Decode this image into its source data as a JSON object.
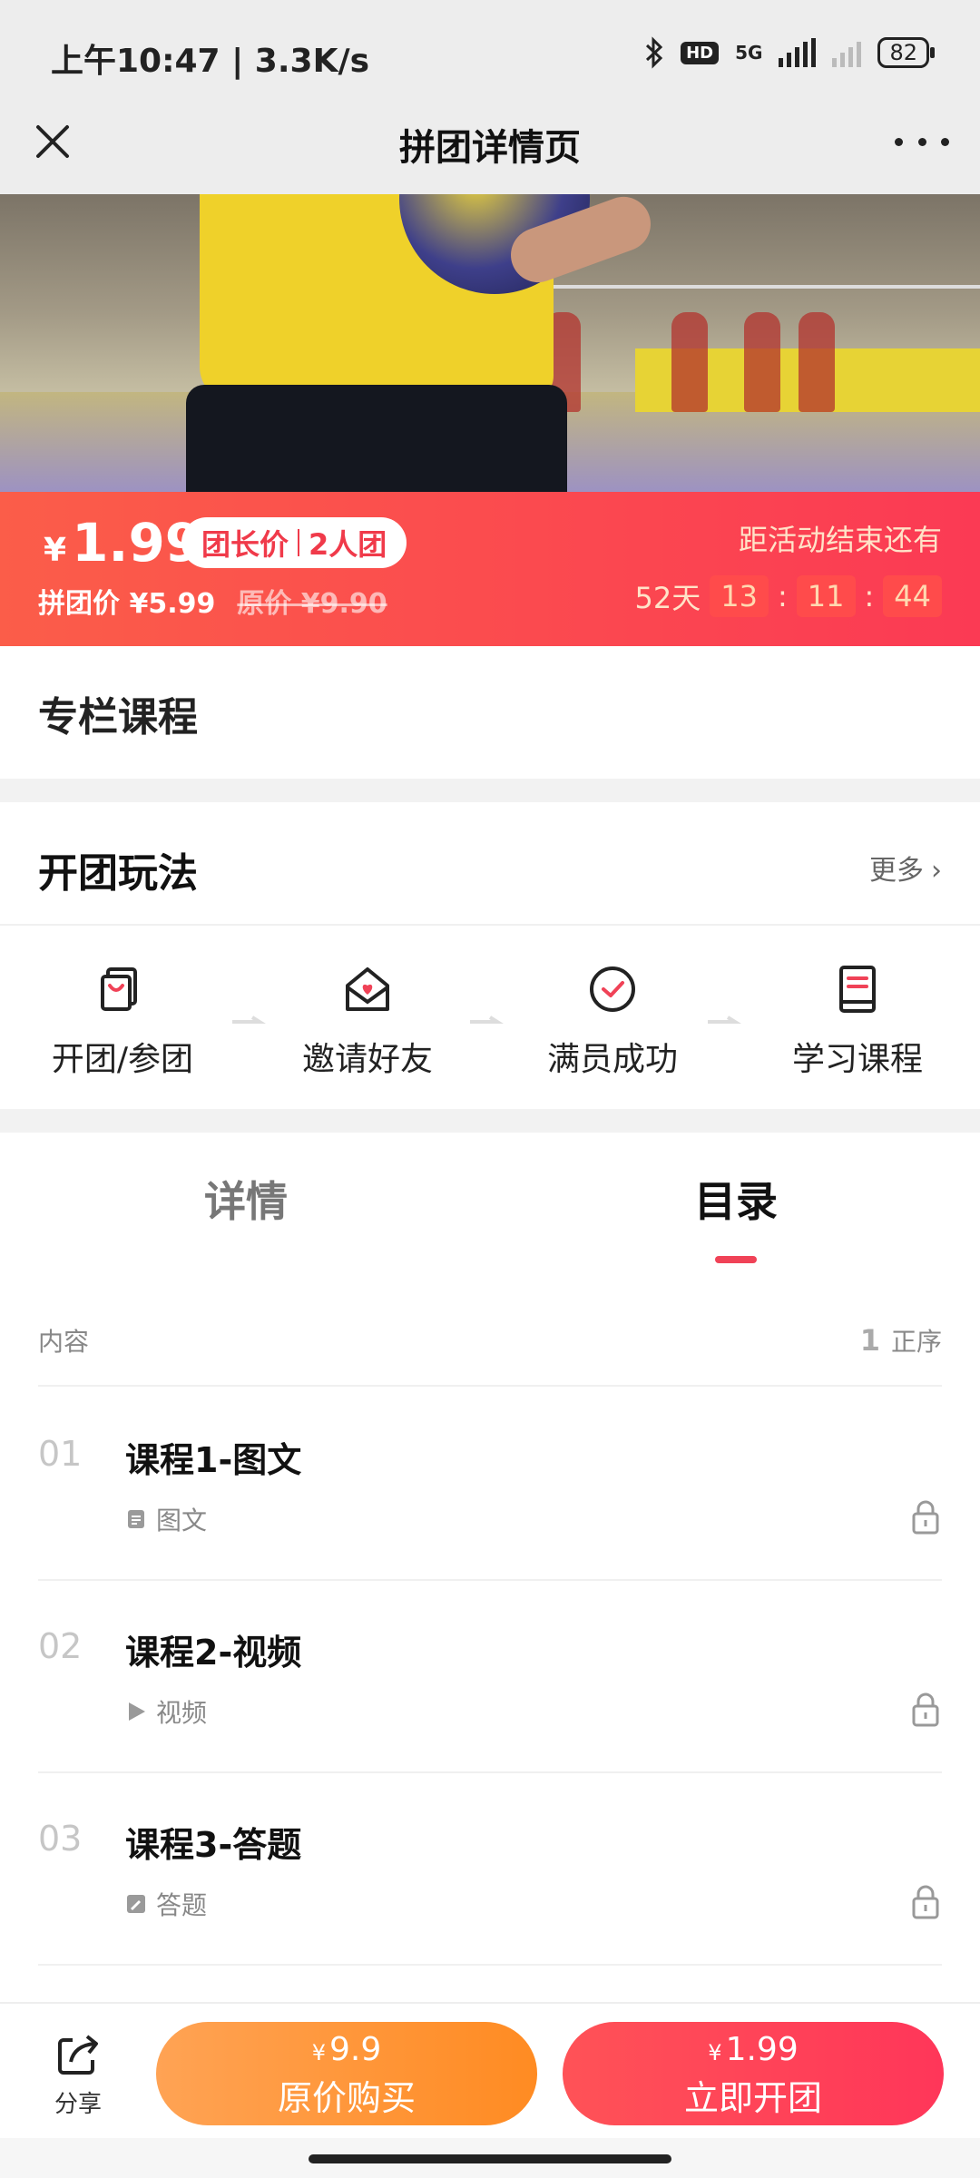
{
  "status_bar": {
    "time_speed": "上午10:47 | 3.3K/s",
    "network": "5G",
    "hd": "HD",
    "battery": "82"
  },
  "nav": {
    "title": "拼团详情页"
  },
  "promo": {
    "currency": "¥",
    "group_leader_price": "1.99",
    "tag_leader": "团长价",
    "tag_size": "2人团",
    "group_price": "拼团价  ¥5.99",
    "original_price": "原价  ¥9.90",
    "ends_label": "距活动结束还有",
    "countdown": {
      "days": "52天",
      "hours": "13",
      "minutes": "11",
      "seconds": "44",
      "sep": ":"
    }
  },
  "column": {
    "heading": "专栏课程"
  },
  "how_to_play": {
    "heading": "开团玩法",
    "more_label": "更多",
    "steps": [
      {
        "label": "开团/参团",
        "icon": "bag-icon"
      },
      {
        "label": "邀请好友",
        "icon": "envelope-heart-icon"
      },
      {
        "label": "满员成功",
        "icon": "check-circle-icon"
      },
      {
        "label": "学习课程",
        "icon": "book-icon"
      }
    ]
  },
  "tabs": {
    "details": "详情",
    "catalog": "目录",
    "active": "catalog"
  },
  "list_header": {
    "content_label": "内容",
    "sort_digit": "1",
    "sort_label": "正序"
  },
  "lessons": [
    {
      "no": "01",
      "title": "课程1-图文",
      "type": "图文",
      "type_icon": "document-icon"
    },
    {
      "no": "02",
      "title": "课程2-视频",
      "type": "视频",
      "type_icon": "play-icon"
    },
    {
      "no": "03",
      "title": "课程3-答题",
      "type": "答题",
      "type_icon": "quiz-icon"
    }
  ],
  "bottom_bar": {
    "share_label": "分享",
    "original_buy": {
      "currency": "¥",
      "price": "9.9",
      "label": "原价购买"
    },
    "start_group": {
      "currency": "¥",
      "price": "1.99",
      "label": "立即开团"
    }
  },
  "colors": {
    "accent_red": "#fb3a54",
    "accent_orange": "#ff8b22"
  }
}
